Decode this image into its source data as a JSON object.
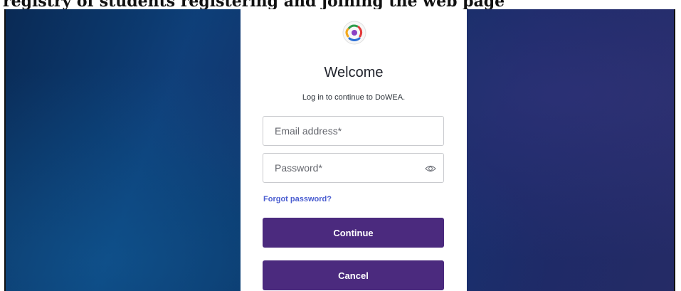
{
  "caption": "registry of students registering and joining the web page",
  "login": {
    "title": "Welcome",
    "subtitle": "Log in to continue to DoWEA.",
    "email_placeholder": "Email address*",
    "password_placeholder": "Password*",
    "forgot_password": "Forgot password?",
    "continue_label": "Continue",
    "cancel_label": "Cancel"
  },
  "icons": {
    "logo": "app-logo-icon",
    "password_toggle": "eye-icon"
  },
  "colors": {
    "button": "#4b2a7e",
    "link": "#4a5dd0",
    "background": "#0c3f78"
  }
}
